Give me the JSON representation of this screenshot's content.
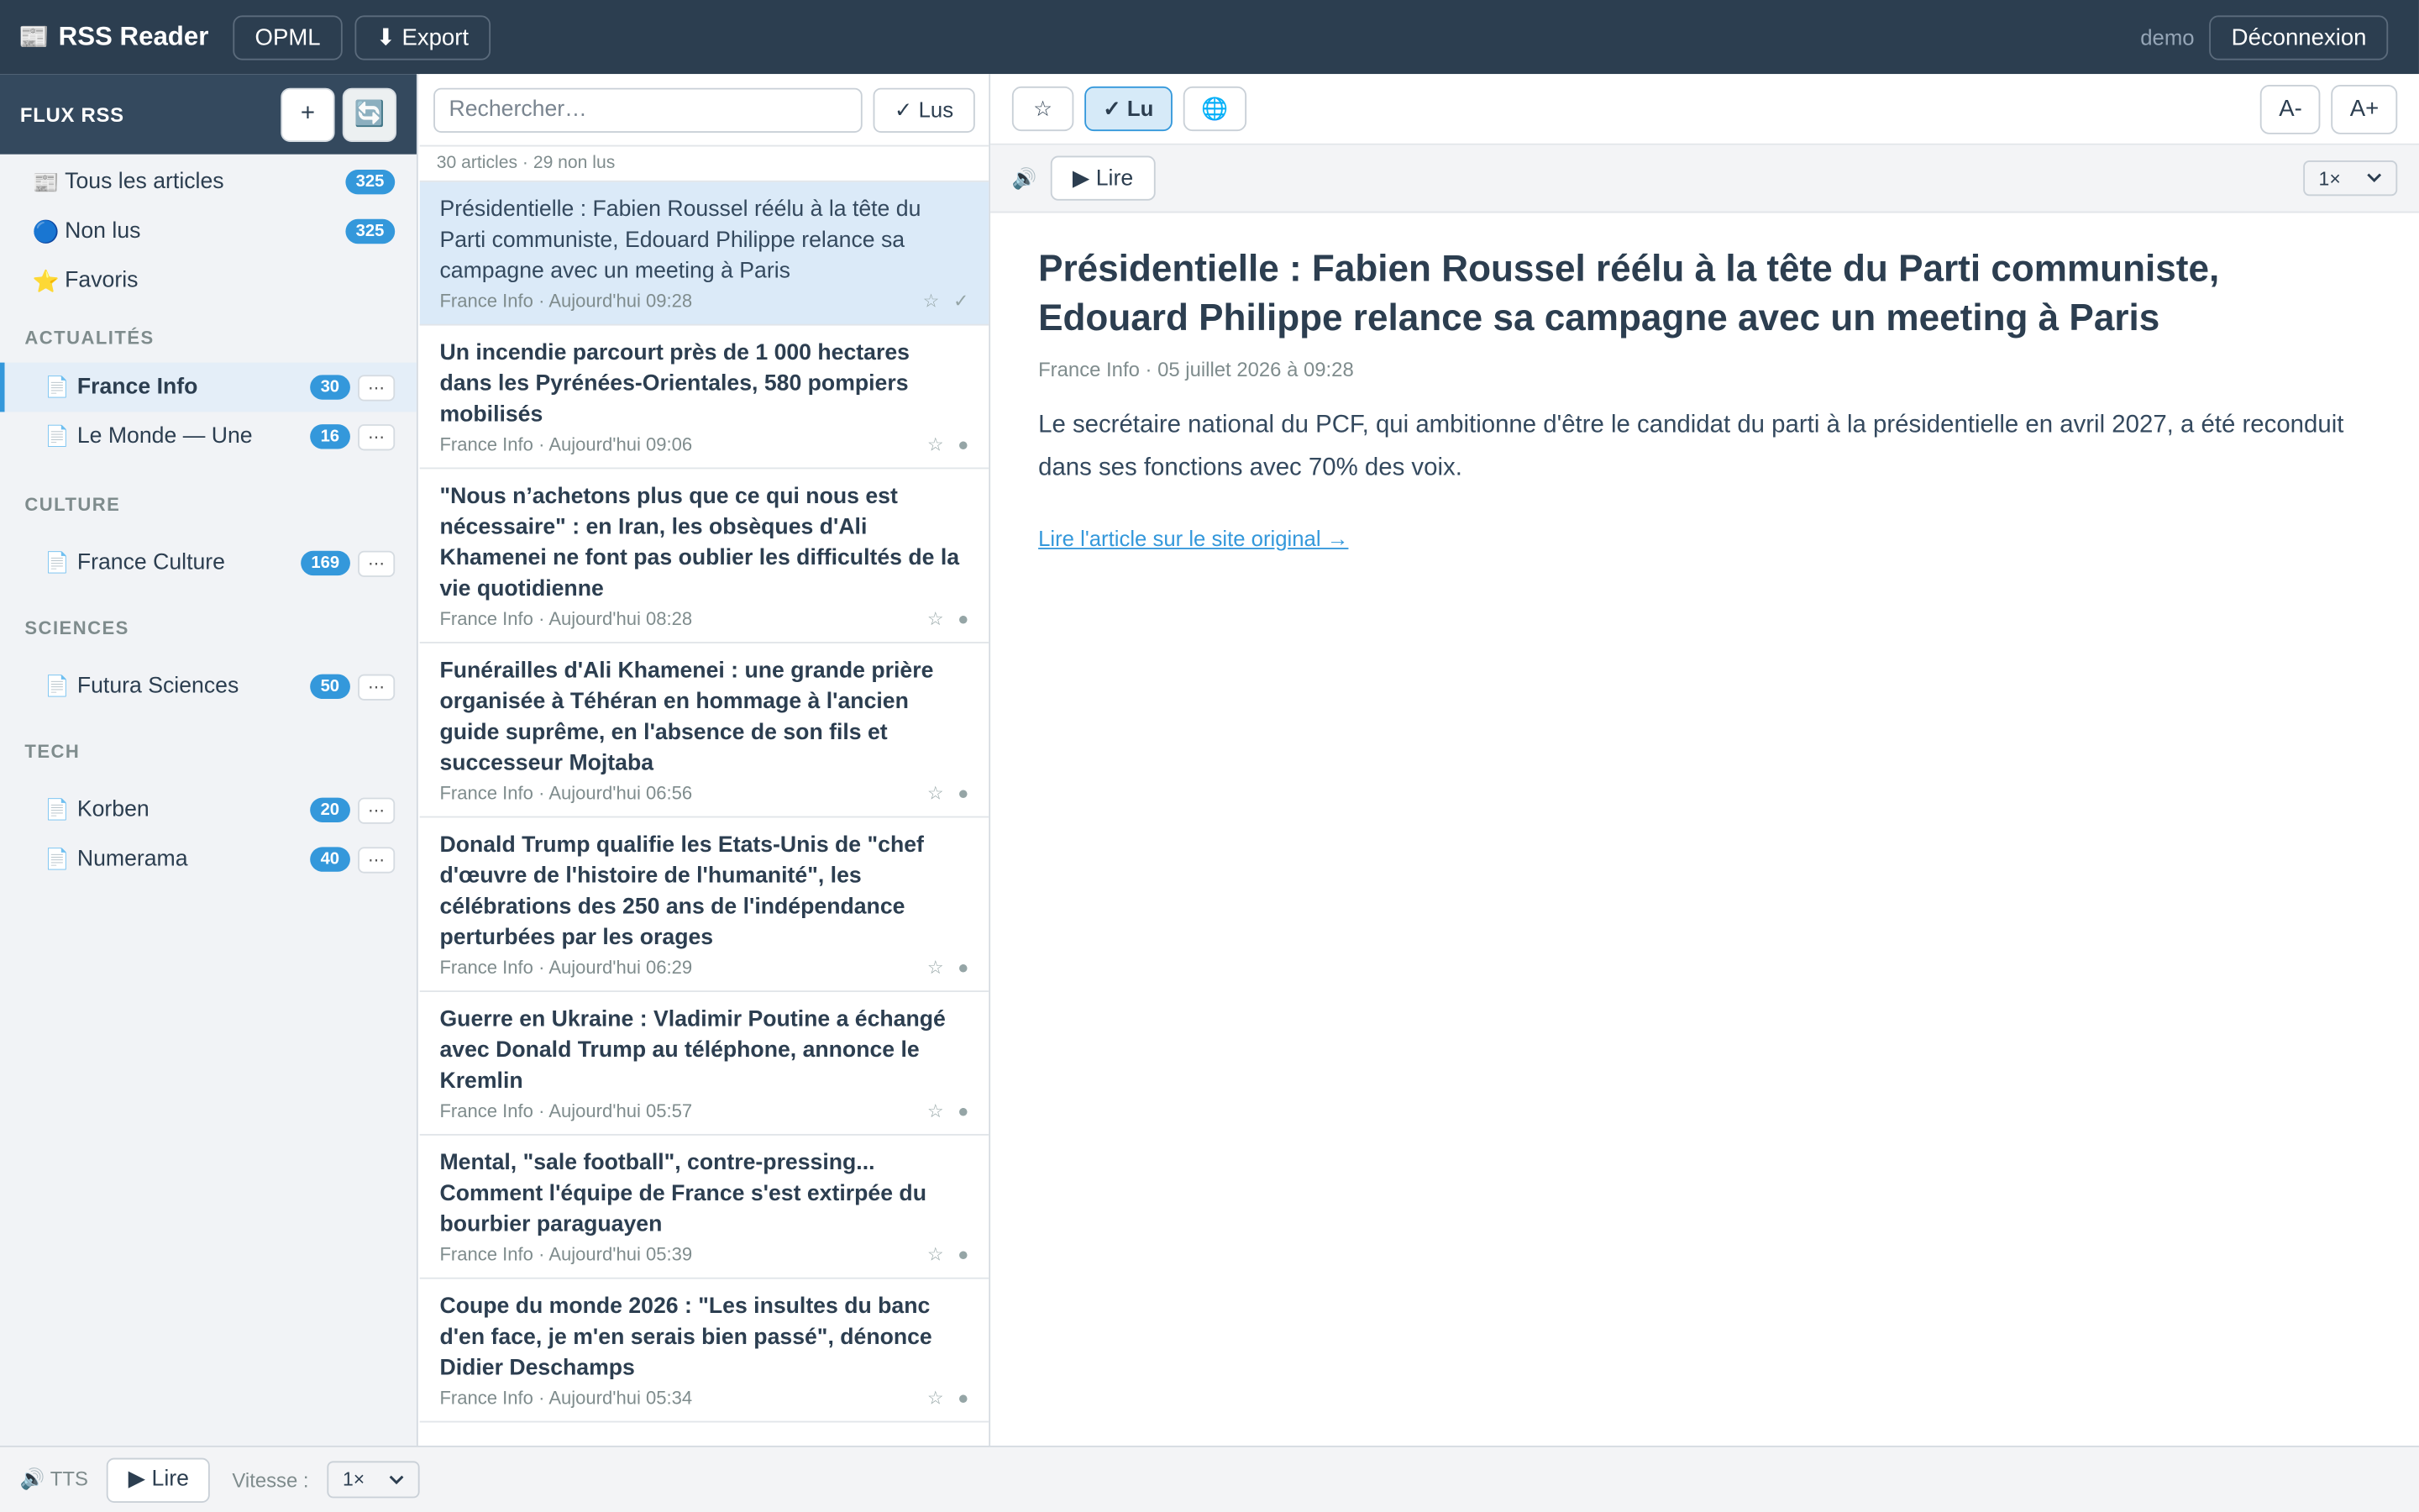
{
  "topbar": {
    "brand_icon": "📰",
    "brand": "RSS Reader",
    "opml": "OPML",
    "export": "⬇ Export",
    "user": "demo",
    "logout": "Déconnexion"
  },
  "sidebar": {
    "title": "FLUX RSS",
    "add": "+",
    "refresh": "🔄",
    "nav": [
      {
        "icon": "📰",
        "label": "Tous les articles",
        "count": "325"
      },
      {
        "icon": "🔵",
        "label": "Non lus",
        "count": "325"
      },
      {
        "icon": "⭐",
        "label": "Favoris"
      }
    ],
    "categories": [
      {
        "name": "ACTUALITÉS",
        "feeds": [
          {
            "label": "France Info",
            "count": "30"
          },
          {
            "label": "Le Monde — Une",
            "count": "16"
          }
        ]
      },
      {
        "name": "CULTURE",
        "feeds": [
          {
            "label": "France Culture",
            "count": "169"
          }
        ]
      },
      {
        "name": "SCIENCES",
        "feeds": [
          {
            "label": "Futura Sciences",
            "count": "50"
          }
        ]
      },
      {
        "name": "TECH",
        "feeds": [
          {
            "label": "Korben",
            "count": "20"
          },
          {
            "label": "Numerama",
            "count": "40"
          }
        ]
      }
    ],
    "feed_icon": "📄",
    "more": "⋯"
  },
  "list": {
    "search_placeholder": "Rechercher…",
    "lus": "✓ Lus",
    "count": "30 articles · 29 non lus",
    "articles": [
      {
        "title": "Présidentielle : Fabien Roussel réélu à la tête du Parti communiste, Edouard Philippe relance sa campagne avec un meeting à Paris",
        "meta": "France Info · Aujourd'hui 09:28",
        "star": "☆",
        "state": "✓"
      },
      {
        "title": "Un incendie parcourt près de 1 000 hectares dans les Pyrénées-Orientales, 580 pompiers mobilisés",
        "meta": "France Info · Aujourd'hui 09:06",
        "star": "☆",
        "state": "●"
      },
      {
        "title": "\"Nous n’achetons plus que ce qui nous est nécessaire\" : en Iran, les obsèques d'Ali Khamenei ne font pas oublier les difficultés de la vie quotidienne",
        "meta": "France Info · Aujourd'hui 08:28",
        "star": "☆",
        "state": "●"
      },
      {
        "title": "Funérailles d'Ali Khamenei : une grande prière organisée à Téhéran en hommage à l'ancien guide suprême, en l'absence de son fils et successeur Mojtaba",
        "meta": "France Info · Aujourd'hui 06:56",
        "star": "☆",
        "state": "●"
      },
      {
        "title": "Donald Trump qualifie les Etats-Unis de \"chef d'œuvre de l'histoire de l'humanité\", les célébrations des 250 ans de l'indépendance perturbées par les orages",
        "meta": "France Info · Aujourd'hui 06:29",
        "star": "☆",
        "state": "●"
      },
      {
        "title": "Guerre en Ukraine : Vladimir Poutine a échangé avec Donald Trump au téléphone, annonce le Kremlin",
        "meta": "France Info · Aujourd'hui 05:57",
        "star": "☆",
        "state": "●"
      },
      {
        "title": "Mental, \"sale football\", contre-pressing... Comment l'équipe de France s'est extirpée du bourbier paraguayen",
        "meta": "France Info · Aujourd'hui 05:39",
        "star": "☆",
        "state": "●"
      },
      {
        "title": "Coupe du monde 2026 : \"Les insultes du banc d'en face, je m'en serais bien passé\", dénonce Didier Deschamps",
        "meta": "France Info · Aujourd'hui 05:34",
        "star": "☆",
        "state": "●"
      }
    ]
  },
  "reader": {
    "star": "☆",
    "read": "✓ Lu",
    "globe": "🌐",
    "font_smaller": "A-",
    "font_larger": "A+",
    "speaker": "🔊",
    "play": "▶ Lire",
    "speed": "1×",
    "title": "Présidentielle : Fabien Roussel réélu à la tête du Parti communiste, Edouard Philippe relance sa campagne avec un meeting à Paris",
    "meta": "France Info · 05 juillet 2026 à 09:28",
    "body": "Le secrétaire national du PCF, qui ambitionne d'être le candidat du parti à la présidentielle en avril 2027, a été reconduit dans ses fonctions avec 70% des voix.",
    "link": "Lire l'article sur le site original →"
  },
  "bottom": {
    "tts": "🔊 TTS",
    "play": "▶ Lire",
    "vitesse": "Vitesse :",
    "speed": "1×"
  }
}
